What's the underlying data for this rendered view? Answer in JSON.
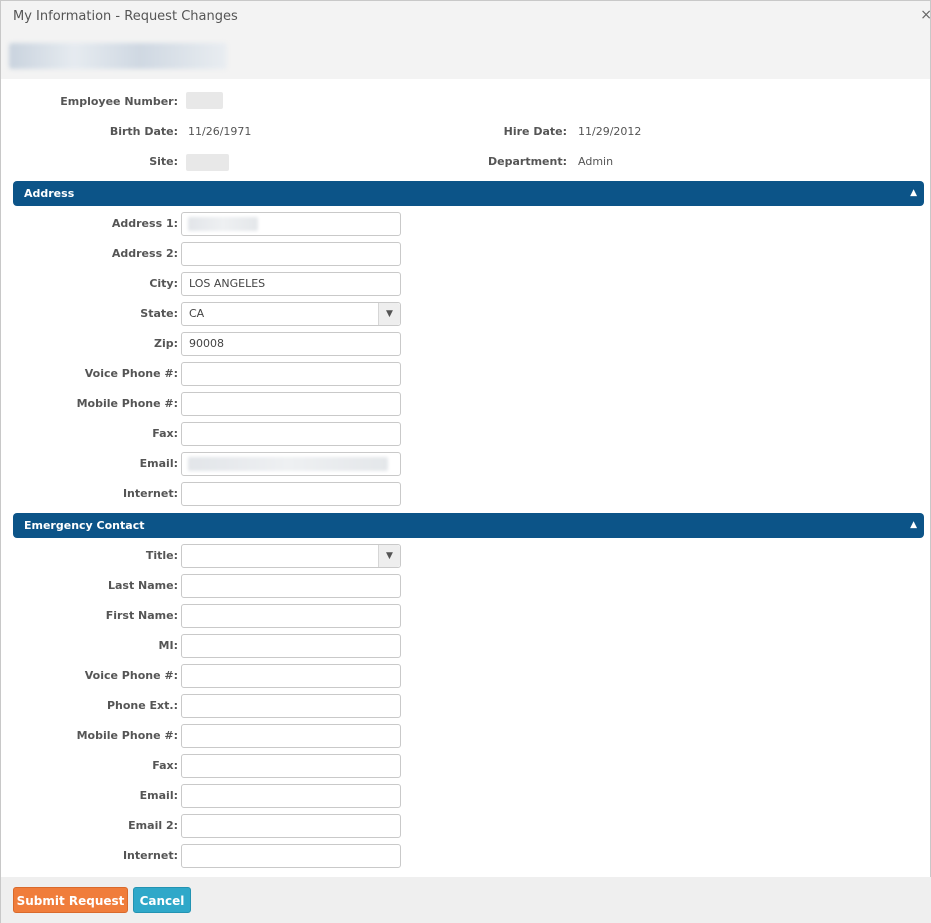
{
  "dialog": {
    "title": "My Information - Request Changes",
    "close_icon": "×"
  },
  "info": {
    "employee_number_label": "Employee Number:",
    "birth_date_label": "Birth Date:",
    "birth_date_value": "11/26/1971",
    "hire_date_label": "Hire Date:",
    "hire_date_value": "11/29/2012",
    "site_label": "Site:",
    "department_label": "Department:",
    "department_value": "Admin"
  },
  "address": {
    "header": "Address",
    "fields": [
      {
        "label": "Address 1:",
        "value": ""
      },
      {
        "label": "Address 2:",
        "value": ""
      },
      {
        "label": "City:",
        "value": "LOS ANGELES"
      },
      {
        "label": "State:",
        "value": "CA"
      },
      {
        "label": "Zip:",
        "value": "90008"
      },
      {
        "label": "Voice Phone #:",
        "value": ""
      },
      {
        "label": "Mobile Phone #:",
        "value": ""
      },
      {
        "label": "Fax:",
        "value": ""
      },
      {
        "label": "Email:",
        "value": ""
      },
      {
        "label": "Internet:",
        "value": ""
      }
    ]
  },
  "emergency": {
    "header": "Emergency Contact",
    "fields": [
      {
        "label": "Title:",
        "value": ""
      },
      {
        "label": "Last Name:",
        "value": ""
      },
      {
        "label": "First Name:",
        "value": ""
      },
      {
        "label": "MI:",
        "value": ""
      },
      {
        "label": "Voice Phone #:",
        "value": ""
      },
      {
        "label": "Phone Ext.:",
        "value": ""
      },
      {
        "label": "Mobile Phone #:",
        "value": ""
      },
      {
        "label": "Fax:",
        "value": ""
      },
      {
        "label": "Email:",
        "value": ""
      },
      {
        "label": "Email 2:",
        "value": ""
      },
      {
        "label": "Internet:",
        "value": ""
      }
    ]
  },
  "footer": {
    "submit_label": "Submit Request",
    "cancel_label": "Cancel"
  },
  "colors": {
    "section_header": "#0c5488",
    "submit_button": "#f07d3b",
    "cancel_button": "#2fa8c9"
  }
}
